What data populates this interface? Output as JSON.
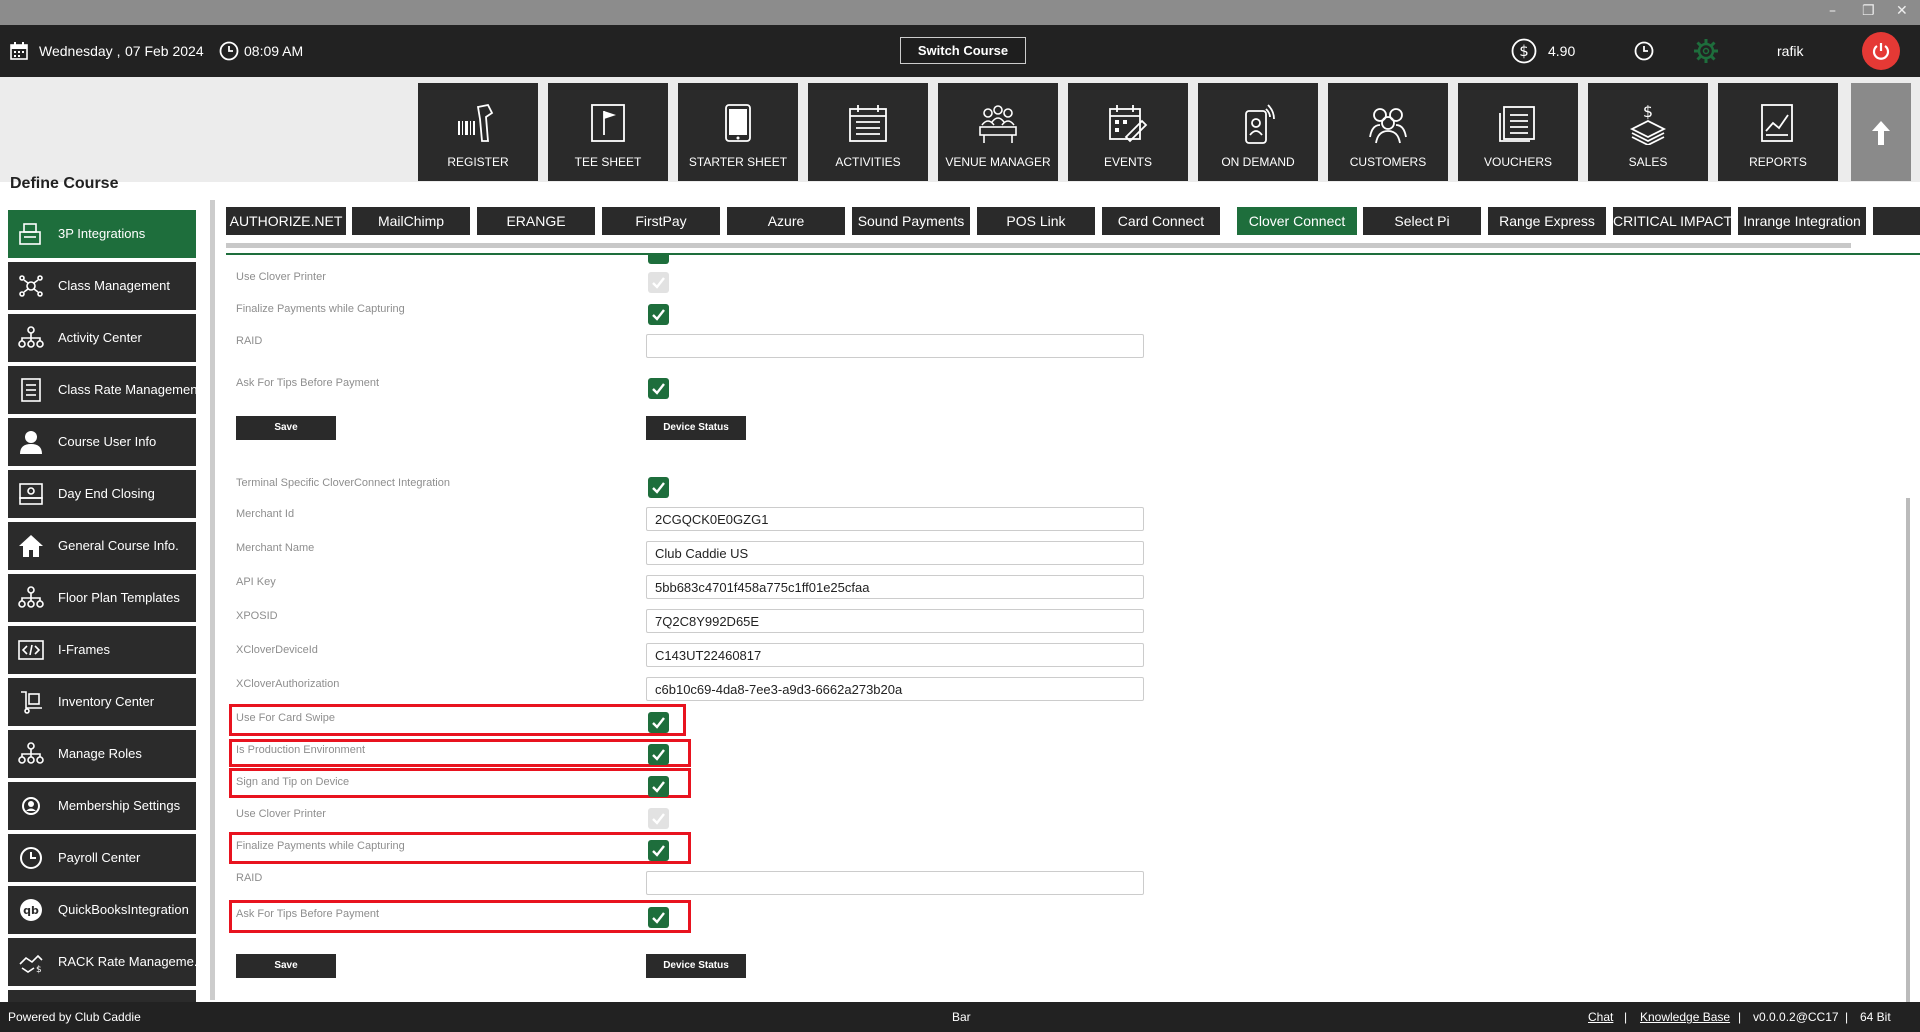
{
  "topbar": {
    "day": "Wednesday ,",
    "date": "07 Feb 2024",
    "time": "08:09 AM",
    "switch_course": "Switch Course",
    "balance": "4.90",
    "user": "rafik"
  },
  "modules": [
    {
      "label": "REGISTER",
      "icon": "barcode-scanner-icon"
    },
    {
      "label": "TEE SHEET",
      "icon": "flag-sheet-icon"
    },
    {
      "label": "STARTER SHEET",
      "icon": "tablet-icon"
    },
    {
      "label": "ACTIVITIES",
      "icon": "calendar-list-icon"
    },
    {
      "label": "VENUE MANAGER",
      "icon": "meeting-table-icon"
    },
    {
      "label": "EVENTS",
      "icon": "calendar-edit-icon"
    },
    {
      "label": "ON DEMAND",
      "icon": "mobile-signal-icon"
    },
    {
      "label": "CUSTOMERS",
      "icon": "people-group-icon"
    },
    {
      "label": "VOUCHERS",
      "icon": "voucher-list-icon"
    },
    {
      "label": "SALES",
      "icon": "money-stack-icon"
    },
    {
      "label": "REPORTS",
      "icon": "report-chart-icon"
    }
  ],
  "page_title": "Define Course",
  "sidebar": {
    "items": [
      {
        "label": "3P Integrations",
        "active": true
      },
      {
        "label": "Class Management"
      },
      {
        "label": "Activity  Center"
      },
      {
        "label": "Class Rate Management"
      },
      {
        "label": "Course User Info"
      },
      {
        "label": "Day End Closing"
      },
      {
        "label": "General Course Info."
      },
      {
        "label": "Floor Plan Templates"
      },
      {
        "label": "I-Frames"
      },
      {
        "label": "Inventory Center"
      },
      {
        "label": "Manage Roles"
      },
      {
        "label": "Membership Settings"
      },
      {
        "label": "Payroll Center"
      },
      {
        "label": "QuickBooksIntegration"
      },
      {
        "label": "RACK Rate Manageme..."
      }
    ]
  },
  "tabs": [
    {
      "label": "AUTHORIZE.NET"
    },
    {
      "label": "MailChimp"
    },
    {
      "label": "ERANGE"
    },
    {
      "label": "FirstPay"
    },
    {
      "label": "Azure"
    },
    {
      "label": "Sound Payments"
    },
    {
      "label": "POS Link"
    },
    {
      "label": "Card Connect"
    },
    {
      "label": "Clover Connect",
      "active": true
    },
    {
      "label": "Select Pi"
    },
    {
      "label": "Range Express"
    },
    {
      "label": "CRITICAL IMPACT"
    },
    {
      "label": "Inrange Integration"
    }
  ],
  "form_top": {
    "use_clover_printer": {
      "label": "Use Clover Printer",
      "checked": false
    },
    "finalize_payments": {
      "label": "Finalize Payments while Capturing",
      "checked": true
    },
    "raid": {
      "label": "RAID",
      "value": ""
    },
    "ask_for_tips": {
      "label": "Ask For Tips Before Payment",
      "checked": true
    },
    "save": "Save",
    "device_status": "Device Status"
  },
  "form_terminal": {
    "terminal_specific": {
      "label": "Terminal Specific CloverConnect Integration",
      "checked": true
    },
    "merchant_id": {
      "label": "Merchant Id",
      "value": "2CGQCK0E0GZG1"
    },
    "merchant_name": {
      "label": "Merchant Name",
      "value": "Club Caddie US"
    },
    "api_key": {
      "label": "API Key",
      "value": "5bb683c4701f458a775c1ff01e25cfaa"
    },
    "xposid": {
      "label": "XPOSID",
      "value": "7Q2C8Y992D65E"
    },
    "xclover_device_id": {
      "label": "XCloverDeviceId",
      "value": "C143UT22460817"
    },
    "xclover_authorization": {
      "label": "XCloverAuthorization",
      "value": "c6b10c69-4da8-7ee3-a9d3-6662a273b20a"
    },
    "use_for_card_swipe": {
      "label": "Use For Card Swipe",
      "checked": true
    },
    "is_production": {
      "label": "Is Production Environment",
      "checked": true
    },
    "sign_and_tip": {
      "label": "Sign and Tip on Device",
      "checked": true
    },
    "use_clover_printer": {
      "label": "Use Clover Printer",
      "checked": false
    },
    "finalize_payments": {
      "label": "Finalize Payments while Capturing",
      "checked": true
    },
    "raid": {
      "label": "RAID",
      "value": ""
    },
    "ask_for_tips": {
      "label": "Ask For Tips Before Payment",
      "checked": true
    },
    "save": "Save",
    "device_status": "Device Status"
  },
  "footer": {
    "powered_by": "Powered by Club Caddie",
    "location": "Bar",
    "chat": "Chat",
    "sep1": "|",
    "knowledge_base": "Knowledge Base",
    "sep2": "|",
    "version": "v0.0.0.2@CC17",
    "sep3": "|",
    "bits": "64 Bit"
  },
  "colors": {
    "accent_green": "#1e6e3c",
    "highlight_red": "#e8131f",
    "dark": "#222222",
    "power_red": "#e53935"
  }
}
